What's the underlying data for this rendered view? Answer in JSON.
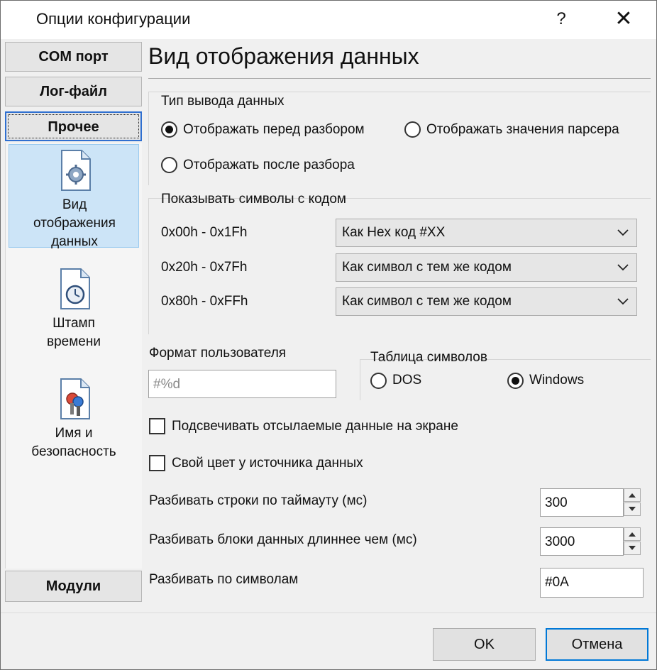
{
  "window": {
    "title": "Опции конфигурации",
    "help_label": "?",
    "close_label": "✕"
  },
  "sidebar": {
    "buttons": [
      "COM порт",
      "Лог-файл",
      "Прочее"
    ],
    "bottom_button": "Модули",
    "items": [
      {
        "label_lines": [
          "Вид",
          "отображения",
          "данных"
        ],
        "icon": "settings-document-icon"
      },
      {
        "label_lines": [
          "Штамп",
          "времени"
        ],
        "icon": "clock-document-icon"
      },
      {
        "label_lines": [
          "Имя и",
          "безопасность"
        ],
        "icon": "key-document-icon"
      }
    ]
  },
  "main": {
    "heading": "Вид отображения данных",
    "output_type": {
      "title": "Тип вывода данных",
      "options": [
        "Отображать перед разбором",
        "Отображать значения парсера",
        "Отображать после разбора"
      ],
      "selected": "Отображать перед разбором"
    },
    "symbols": {
      "title": "Показывать символы с кодом",
      "rows": [
        {
          "range": "0x00h - 0x1Fh",
          "value": "Как Hex код #XX"
        },
        {
          "range": "0x20h - 0x7Fh",
          "value": "Как символ с тем же кодом"
        },
        {
          "range": "0x80h - 0xFFh",
          "value": "Как символ с тем же кодом"
        }
      ]
    },
    "user_format": {
      "label": "Формат пользователя",
      "value": "#%d"
    },
    "charset": {
      "title": "Таблица символов",
      "options": [
        "DOS",
        "Windows"
      ],
      "selected": "Windows"
    },
    "checkboxes": [
      "Подсвечивать отсылаемые данные на экране",
      "Свой цвет у источника данных"
    ],
    "split_timeout": {
      "label": "Разбивать строки по таймауту (мс)",
      "value": "300"
    },
    "split_blocks": {
      "label": "Разбивать блоки данных длиннее чем (мс)",
      "value": "3000"
    },
    "split_symbols": {
      "label": "Разбивать по символам",
      "value": "#0A"
    }
  },
  "footer": {
    "ok_label": "OK",
    "cancel_label": "Отмена"
  },
  "colors": {
    "accent": "#0078d7",
    "selection": "#cce4f7"
  }
}
